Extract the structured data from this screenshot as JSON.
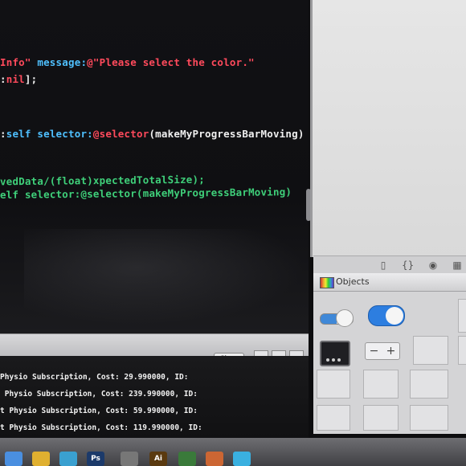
{
  "editor": {
    "lines": [
      {
        "segments": [
          {
            "text": "Info\" ",
            "color": "red"
          },
          {
            "text": "message:",
            "color": "blue"
          },
          {
            "text": "@\"Please select the color.\"",
            "color": "red"
          }
        ]
      },
      {
        "segments": [
          {
            "text": ":",
            "color": "white"
          },
          {
            "text": "nil",
            "color": "red"
          },
          {
            "text": "];",
            "color": "white"
          }
        ]
      },
      {
        "segments": [
          {
            "text": ":",
            "color": "white"
          },
          {
            "text": "self ",
            "color": "blue"
          },
          {
            "text": "selector:",
            "color": "blue"
          },
          {
            "text": "@selector",
            "color": "red"
          },
          {
            "text": "(makeMyProgressBarMoving)",
            "color": "white"
          }
        ]
      },
      {
        "segments": [
          {
            "text": "vedData/(float)xpectedTotalSize);",
            "color": "green"
          }
        ]
      },
      {
        "segments": [
          {
            "text": "elf selector:@selector(makeMyProgressBarMoving)",
            "color": "green"
          }
        ]
      }
    ]
  },
  "library": {
    "title": "Objects",
    "stepper_minus": "−",
    "stepper_plus": "+"
  },
  "console": {
    "clear_label": "Clear",
    "logs": [
      "Physio Subscription, Cost: 29.990000, ID:",
      " Physio Subscription, Cost: 239.990000, ID:",
      "t Physio Subscription, Cost: 59.990000, ID:",
      "t Physio Subscription, Cost: 119.990000, ID:"
    ]
  },
  "inspector_tabs": [
    "file-icon",
    "braces-icon",
    "cube-icon",
    "grid-icon"
  ],
  "dock": {
    "items": [
      {
        "icon": "finder-icon",
        "label": "",
        "color": "#4a8fe0"
      },
      {
        "icon": "chrome-icon",
        "label": "",
        "color": "#e0b030"
      },
      {
        "icon": "safari-icon",
        "label": "",
        "color": "#3aa0d0"
      },
      {
        "icon": "photoshop-icon",
        "label": "Ps",
        "color": "#1c3a6a"
      },
      {
        "icon": "app-icon",
        "label": "",
        "color": "#777"
      },
      {
        "icon": "illustrator-icon",
        "label": "Ai",
        "color": "#5a3a10"
      },
      {
        "icon": "app-icon-2",
        "label": "",
        "color": "#3a7a3a"
      },
      {
        "icon": "app-icon-3",
        "label": "",
        "color": "#cc6633"
      },
      {
        "icon": "twitter-icon",
        "label": "",
        "color": "#3ab0e0"
      }
    ]
  },
  "colors": {
    "red": "#ff4a5c",
    "blue": "#4fc0ff",
    "white": "#f0f0f0",
    "green": "#3fd07a"
  }
}
